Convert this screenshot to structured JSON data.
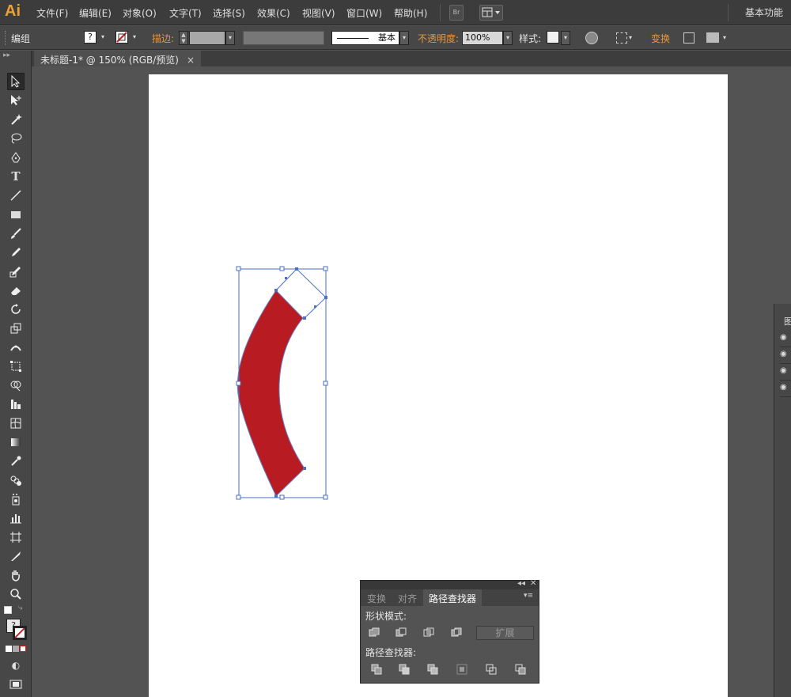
{
  "app": {
    "logo": "Ai",
    "workspace": "基本功能"
  },
  "menu": [
    "文件(F)",
    "编辑(E)",
    "对象(O)",
    "文字(T)",
    "选择(S)",
    "效果(C)",
    "视图(V)",
    "窗口(W)",
    "帮助(H)"
  ],
  "menu_box": {
    "bridge": "Br"
  },
  "control": {
    "selection_type": "编组",
    "fill_value": "?",
    "stroke_label": "描边:",
    "stroke_profile": "基本",
    "opacity_label": "不透明度:",
    "opacity_value": "100%",
    "style_label": "样式:",
    "transform_label": "变换"
  },
  "doc_tab": {
    "title": "未标题-1* @ 150% (RGB/预览)",
    "close": "×"
  },
  "fill_swatch_text": "?",
  "colors": {
    "shape_fill": "#b81c22",
    "selection": "#4a6fc7",
    "accent": "#e8963c"
  },
  "pathfinder": {
    "tabs": [
      "变换",
      "对齐",
      "路径查找器"
    ],
    "active_tab": "路径查找器",
    "shape_modes_label": "形状模式:",
    "pathfinders_label": "路径查找器:",
    "expand_label": "扩展",
    "collapse": "◂◂",
    "close": "✕",
    "menu": "▾≡"
  },
  "right_panel": {
    "header": "图"
  }
}
